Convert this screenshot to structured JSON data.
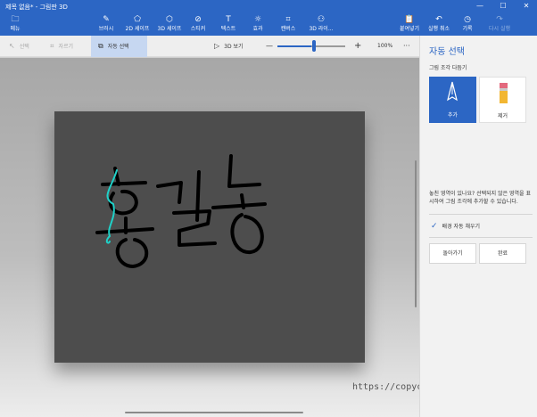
{
  "window": {
    "title": "제목 없음* - 그림판 3D",
    "minimize": "—",
    "maximize": "☐",
    "close": "✕"
  },
  "ribbon": {
    "menu": {
      "label": "메뉴",
      "icon": "folder-icon"
    },
    "tools": [
      {
        "label": "브러시",
        "icon": "brush-icon"
      },
      {
        "label": "2D 셰이프",
        "icon": "2d-shapes-icon"
      },
      {
        "label": "3D 셰이프",
        "icon": "3d-shapes-icon"
      },
      {
        "label": "스티커",
        "icon": "sticker-icon"
      },
      {
        "label": "텍스트",
        "icon": "text-icon"
      },
      {
        "label": "효과",
        "icon": "effects-icon"
      },
      {
        "label": "캔버스",
        "icon": "canvas-icon"
      },
      {
        "label": "3D 라이...",
        "icon": "3d-library-icon"
      }
    ],
    "right": [
      {
        "label": "붙여넣기",
        "icon": "paste-icon"
      },
      {
        "label": "실행 취소",
        "icon": "undo-icon"
      },
      {
        "label": "기록",
        "icon": "history-icon"
      },
      {
        "label": "다시 실행",
        "icon": "redo-icon"
      }
    ]
  },
  "subbar": {
    "select": "선택",
    "crop": "자르기",
    "magic_select": "자동 선택",
    "view_3d": "3D 보기",
    "zoom_minus": "—",
    "zoom_plus": "+",
    "zoom_value": "100%",
    "more": "···",
    "zoom_fraction": 0.5
  },
  "panel": {
    "title": "자동 선택",
    "subtitle": "그림 조각 다듬기",
    "add_label": "추가",
    "remove_label": "제거",
    "description": "놓친 영역이 있나요? 선택되지 않은 영역을 표시하여 그림 조각에 추가할 수 있습니다.",
    "autofill_label": "배경 자동 채우기",
    "back_button": "돌아가기",
    "done_button": "완료"
  },
  "watermark": "https://copycoding.tistory/",
  "colors": {
    "accent": "#2c66c4",
    "canvas": "#4d4d4d",
    "ink": "#000000",
    "selection": "#1fd1c8"
  }
}
